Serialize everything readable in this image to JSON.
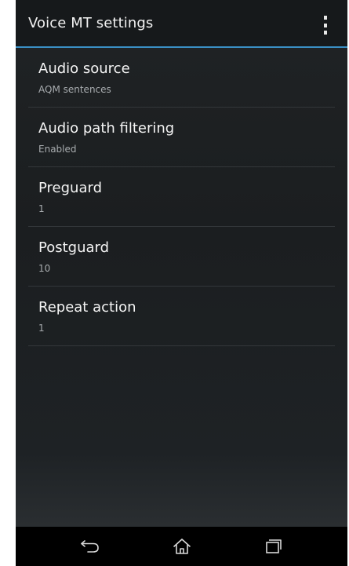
{
  "header": {
    "title": "Voice MT settings",
    "overflow_icon": "overflow-menu-icon"
  },
  "preferences": [
    {
      "title": "Audio source",
      "summary": "AQM sentences"
    },
    {
      "title": "Audio path filtering",
      "summary": "Enabled"
    },
    {
      "title": "Preguard",
      "summary": "1"
    },
    {
      "title": "Postguard",
      "summary": "10"
    },
    {
      "title": "Repeat action",
      "summary": "1"
    }
  ],
  "nav": {
    "back_icon": "back-icon",
    "home_icon": "home-icon",
    "recents_icon": "recents-icon"
  },
  "colors": {
    "accent": "#3a8fc4",
    "action_bar": "#16191b",
    "background": "#1d2022",
    "nav_bar": "#000000",
    "title_text": "#f4f4f4",
    "summary_text": "#a8acaf"
  }
}
